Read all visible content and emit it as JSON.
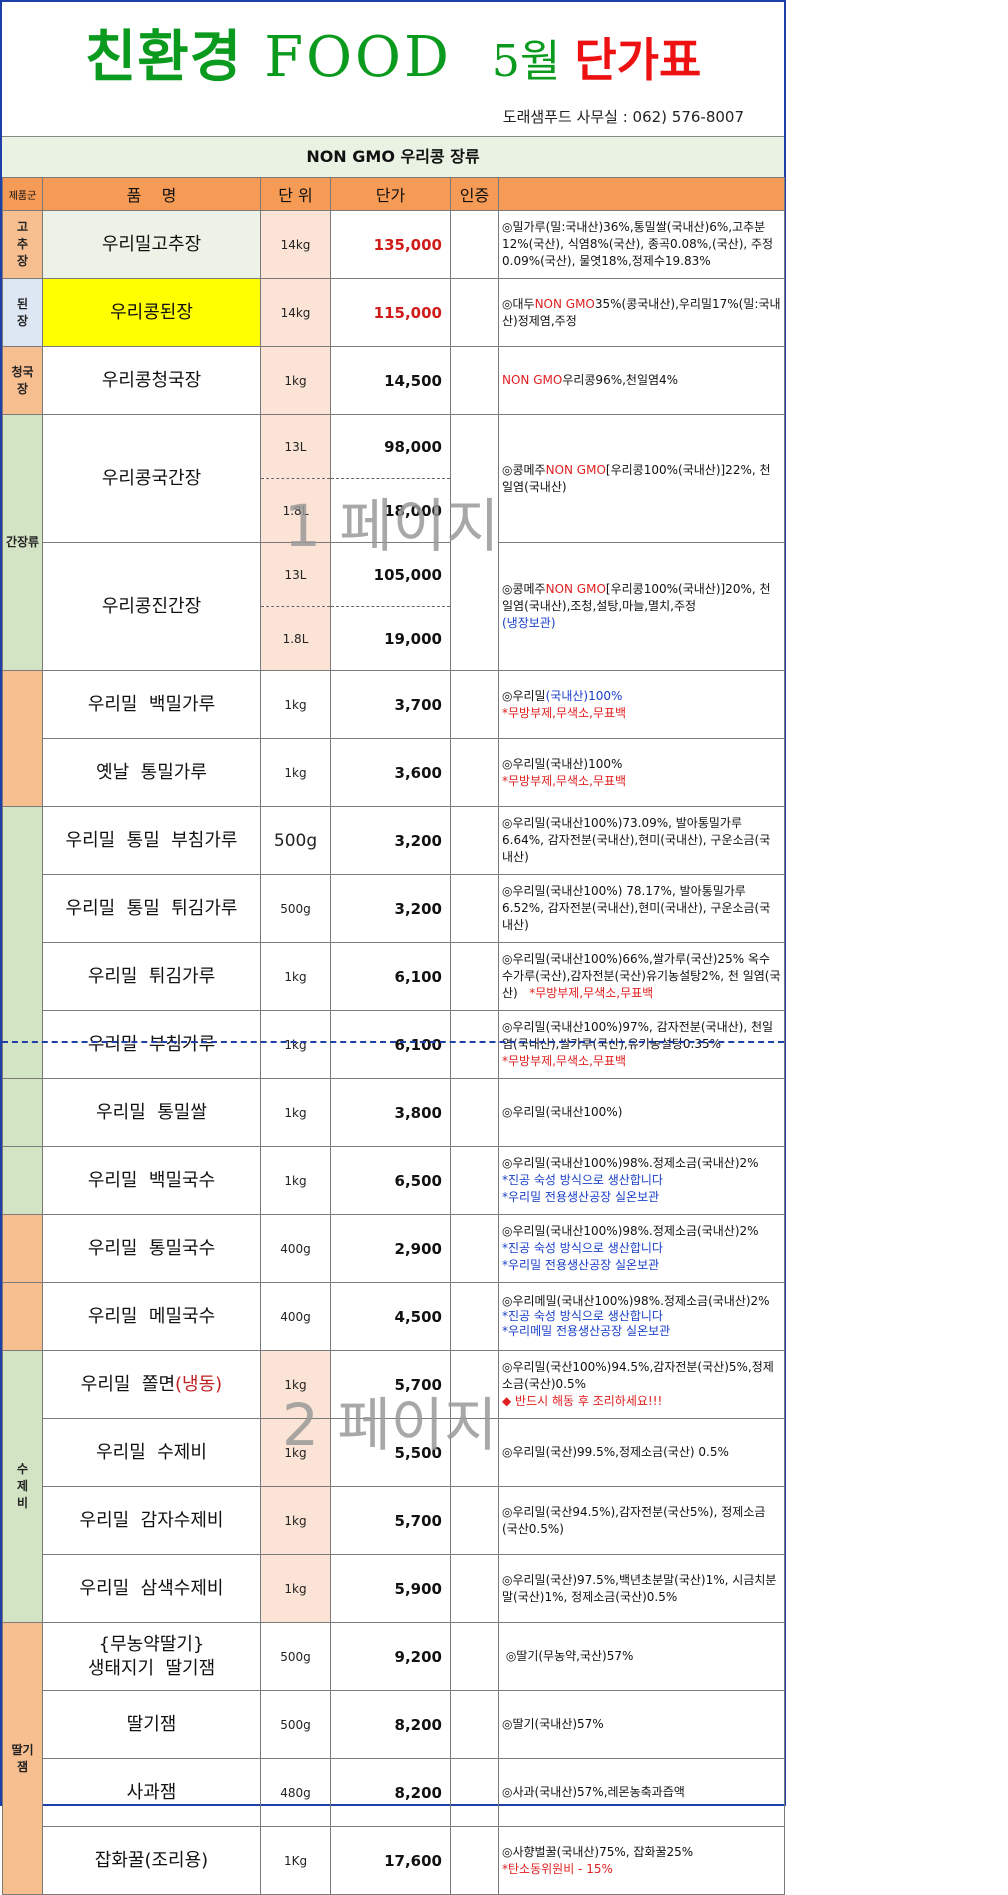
{
  "header": {
    "title_part1": "친환경",
    "title_part2": "FOOD",
    "title_part3": "5월",
    "title_part4": "단가표",
    "office": "도래샘푸드 사무실 : 062) 576-8007"
  },
  "section_title": "NON GMO 우리콩 장류",
  "columns": {
    "category": "제품군",
    "name": "품    명",
    "unit": "단 위",
    "price": "단가",
    "cert": "인증",
    "desc": ""
  },
  "groups": {
    "gochujang": "고추장",
    "doenjang": "된장",
    "cheonggukjang": "청국장",
    "ganjang": "간장류",
    "sujebi": "수제비",
    "jam": "딸기잼"
  },
  "rows": [
    {
      "name": "우리밀고추장",
      "unit": "14kg",
      "price": "135,000",
      "desc": [
        "◎밀가루(밀:국내산)36%,통밀쌀(국내산)6%,고추분12%(국산), 식염8%(국산), 종곡0.08%,(국산), 주정0.09%(국산), 물엿18%,정제수19.83%"
      ]
    },
    {
      "name": "우리콩된장",
      "unit": "14kg",
      "price": "115,000",
      "desc": [
        "◎대두",
        "NON GMO",
        "35%(콩국내산),우리밀17%(밀:국내산)정제염,주정"
      ]
    },
    {
      "name": "우리콩청국장",
      "unit": "1kg",
      "price": "14,500",
      "desc": [
        "NON GMO",
        "우리콩96%,천일염4%"
      ]
    },
    {
      "name": "우리콩국간장",
      "unit_a": "13L",
      "price_a": "98,000",
      "unit_b": "1.8L",
      "price_b": "18,000",
      "desc": [
        "◎콩메주",
        "NON GMO",
        "[우리콩100%(국내산)]22%, 천일염(국내산)"
      ]
    },
    {
      "name": "우리콩진간장",
      "unit_a": "13L",
      "price_a": "105,000",
      "unit_b": "1.8L",
      "price_b": "19,000",
      "desc": [
        "◎콩메주",
        "NON GMO",
        "[우리콩100%(국내산)]20%, 천일염(국내산),조청,설탕,마늘,멸치,주정",
        "(냉장보관)"
      ]
    },
    {
      "name": "우리밀  백밀가루",
      "unit": "1kg",
      "price": "3,700",
      "desc": [
        "◎우리밀",
        "(국내산)100%",
        "*무방부제,무색소,무표백"
      ]
    },
    {
      "name": "옛날  통밀가루",
      "unit": "1kg",
      "price": "3,600",
      "desc": [
        "◎우리밀(국내산)100%",
        "*무방부제,무색소,무표백"
      ]
    },
    {
      "name": "우리밀  통밀  부침가루",
      "unit": "500g",
      "price": "3,200",
      "desc": [
        "◎우리밀(국내산100%)73.09%, 발아통밀가루6.64%, 감자전분(국내산),현미(국내산), 구운소금(국내산)"
      ]
    },
    {
      "name": "우리밀  통밀  튀김가루",
      "unit": "500g",
      "price": "3,200",
      "desc": [
        "◎우리밀(국내산100%) 78.17%, 발아통밀가루6.52%, 감자전분(국내산),현미(국내산), 구운소금(국내산)"
      ]
    },
    {
      "name": "우리밀  튀김가루",
      "unit": "1kg",
      "price": "6,100",
      "desc": [
        "◎우리밀(국내산100%)66%,쌀가루(국산)25%  옥수수가루(국산),감자전분(국산)유기농설탕2%, 천 일염(국산)",
        "*무방부제,무색소,무표백"
      ]
    },
    {
      "name": "우리밀  부침가루",
      "unit": "1kg",
      "price": "6,100",
      "desc": [
        "◎우리밀(국내산100%)97%, 감자전분(국내산), 천일염(국내산),쌀가루(국산),유기농설탕0.35%",
        "*무방부제,무색소,무표백"
      ]
    },
    {
      "name": "우리밀  통밀쌀",
      "unit": "1kg",
      "price": "3,800",
      "desc": [
        "◎우리밀(국내산100%)"
      ]
    },
    {
      "name": "우리밀  백밀국수",
      "unit": "1kg",
      "price": "6,500",
      "desc": [
        "◎우리밀(국내산100%)98%.정제소금(국내산)2%",
        "*진공 숙성 방식으로 생산합니다",
        "*우리밀 전용생산공장 실온보관"
      ]
    },
    {
      "name": "우리밀  통밀국수",
      "unit": "400g",
      "price": "2,900",
      "desc": [
        "◎우리밀(국내산100%)98%.정제소금(국내산)2%",
        "*진공 숙성 방식으로 생산합니다",
        "*우리밀 전용생산공장 실온보관"
      ]
    },
    {
      "name": "우리밀  메밀국수",
      "unit": "400g",
      "price": "4,500",
      "desc": [
        "◎우리메밀(국내산100%)98%.정제소금(국내산)2%",
        "*진공 숙성 방식으로 생산합니다",
        "*우리메밀 전용생산공장 실온보관"
      ]
    },
    {
      "name": "우리밀  쫄면",
      "name_suffix": "(냉동)",
      "unit": "1kg",
      "price": "5,700",
      "desc": [
        "◎우리밀(국산100%)94.5%,감자전분(국산)5%,정제소금(국산)0.5%",
        "◆ 반드시 해동 후  조리하세요!!!"
      ]
    },
    {
      "name": "우리밀  수제비",
      "unit": "1kg",
      "price": "5,500",
      "desc": [
        "◎우리밀(국산)99.5%,정제소금(국산) 0.5%"
      ]
    },
    {
      "name": "우리밀  감자수제비",
      "unit": "1kg",
      "price": "5,700",
      "desc": [
        "◎우리밀(국산94.5%),감자전분(국산5%), 정제소금(국산0.5%)"
      ]
    },
    {
      "name": "우리밀  삼색수제비",
      "unit": "1kg",
      "price": "5,900",
      "desc": [
        "◎우리밀(국산)97.5%,백년초분말(국산)1%,  시금치분말(국산)1%, 정제소금(국산)0.5%"
      ]
    },
    {
      "name": "{무농약딸기}",
      "name_line2": "생태지기  딸기잼",
      "unit": "500g",
      "price": "9,200",
      "desc": [
        " ◎딸기(무농약,국산)57%"
      ]
    },
    {
      "name": "딸기잼",
      "unit": "500g",
      "price": "8,200",
      "desc": [
        "◎딸기(국내산)57%"
      ]
    },
    {
      "name": "사과잼",
      "unit": "480g",
      "price": "8,200",
      "desc": [
        "◎사과(국내산)57%,레몬농축과즙액"
      ]
    },
    {
      "name": "잡화꿀(조리용)",
      "unit": "1Kg",
      "price": "17,600",
      "desc": [
        "◎사향벌꿀(국내산)75%, 잡화꿀25%",
        "*탄소동위원비 - 15%"
      ]
    }
  ],
  "watermarks": {
    "page1": "1 페이지",
    "page2": "2 페이지"
  },
  "colors": {
    "title_green": "#0a9a1d",
    "title_red": "#ee1111",
    "header_orange": "#f69b55",
    "group_green": "#d3e4c5",
    "group_orange": "#f7bf90",
    "price_red": "#d11a1a",
    "note_red": "#e02020",
    "note_blue": "#1a3fc8",
    "highlight_yellow": "#ffff00"
  }
}
